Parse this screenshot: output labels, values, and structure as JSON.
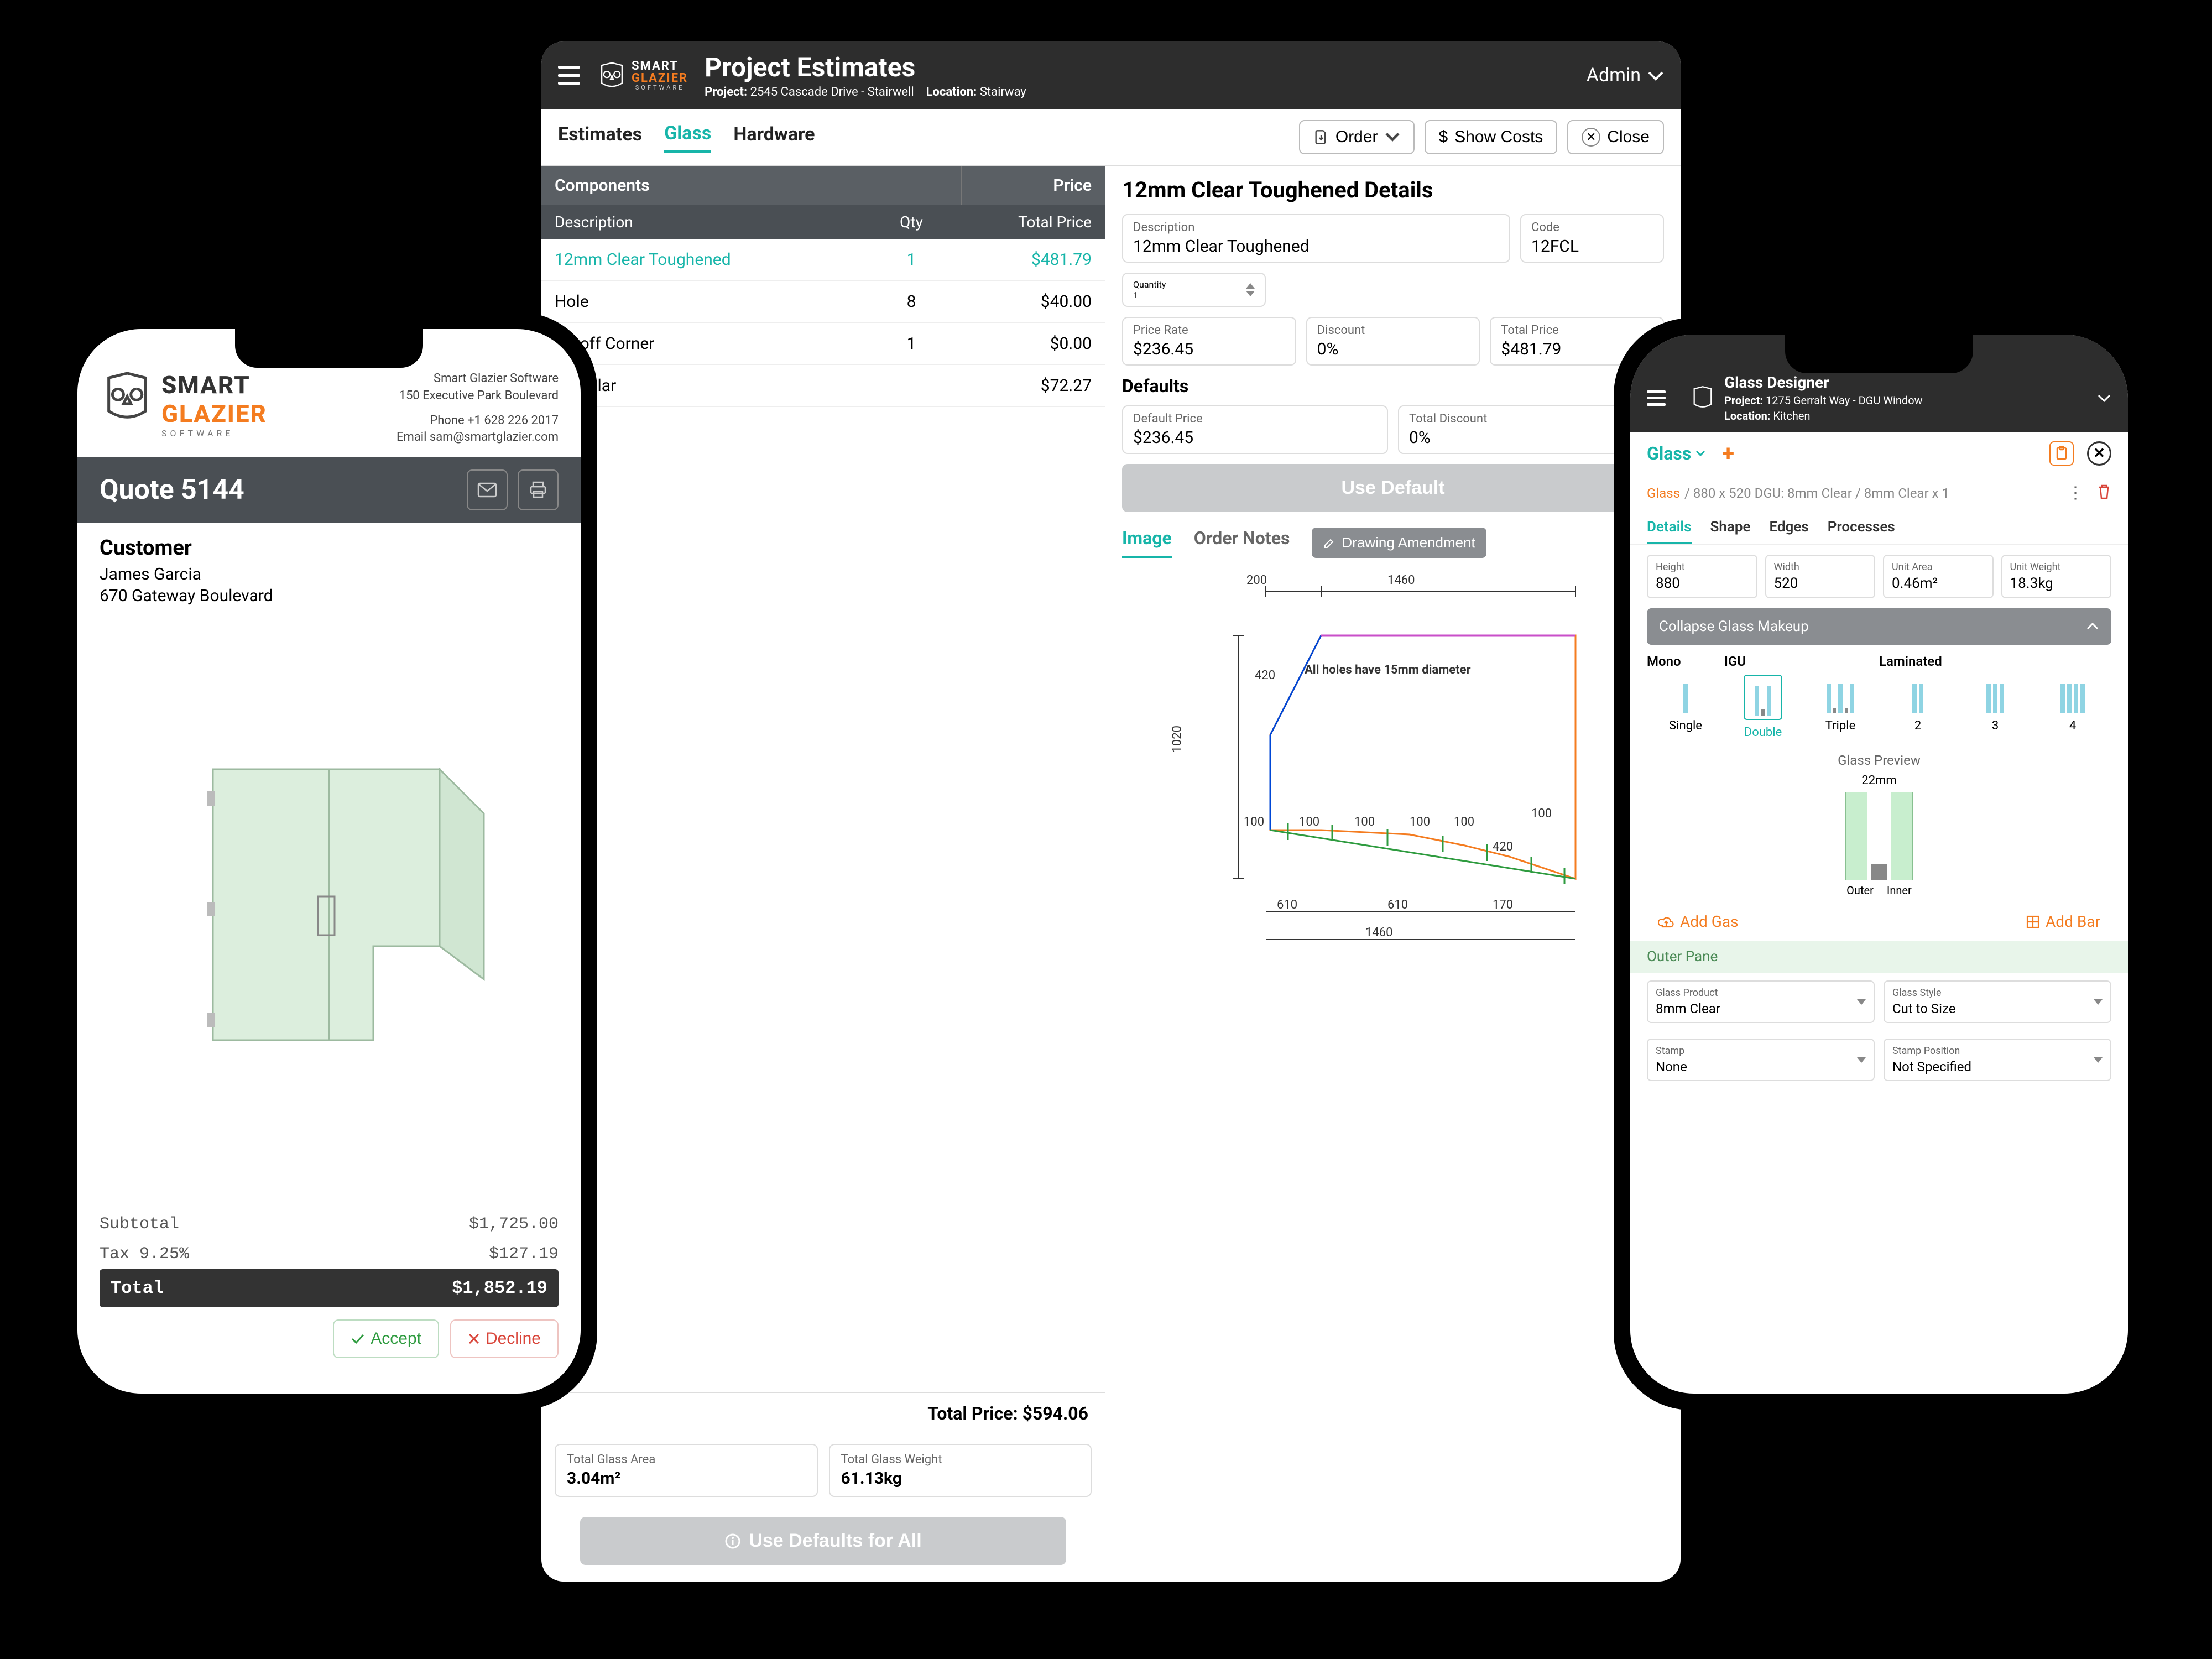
{
  "tablet": {
    "brand": {
      "smart": "SMART",
      "glazier": "GLAZIER",
      "software": "SOFTWARE"
    },
    "title": "Project Estimates",
    "project_lbl": "Project:",
    "project_val": "2545 Cascade Drive - Stairwell",
    "location_lbl": "Location:",
    "location_val": "Stairway",
    "admin": "Admin",
    "tabs": [
      "Estimates",
      "Glass",
      "Hardware"
    ],
    "active_tab": 1,
    "toolbar": {
      "order": "Order",
      "show_costs": "Show Costs",
      "close": "Close"
    },
    "comp_head": {
      "components": "Components",
      "price": "Price",
      "description": "Description",
      "qty": "Qty",
      "total_price": "Total Price"
    },
    "rows": [
      {
        "desc": "12mm Clear Toughened",
        "qty": "1",
        "price": "$481.79",
        "sel": true
      },
      {
        "desc": "Hole",
        "qty": "8",
        "price": "$40.00"
      },
      {
        "desc": "Cutoff Corner",
        "qty": "1",
        "price": "$0.00"
      },
      {
        "desc": "Irregular",
        "qty": "",
        "price": "$72.27"
      }
    ],
    "total_price_lbl": "Total Price:",
    "total_price_val": "$594.06",
    "stat1_lbl": "Total Glass Area",
    "stat1_val": "3.04m²",
    "stat2_lbl": "Total Glass Weight",
    "stat2_val": "61.13kg",
    "use_defaults_all": "Use Defaults for All",
    "details": {
      "title": "12mm Clear Toughened Details",
      "desc_lbl": "Description",
      "desc_val": "12mm Clear Toughened",
      "code_lbl": "Code",
      "code_val": "12FCL",
      "qty_lbl": "Quantity",
      "qty_val": "1",
      "rate_lbl": "Price Rate",
      "rate_val": "$236.45",
      "disc_lbl": "Discount",
      "disc_val": "0%",
      "tp_lbl": "Total Price",
      "tp_val": "$481.79",
      "defaults": "Defaults",
      "dp_lbl": "Default Price",
      "dp_val": "$236.45",
      "td_lbl": "Total Discount",
      "td_val": "0%",
      "use_default": "Use Default",
      "tab_image": "Image",
      "tab_notes": "Order Notes",
      "draw_amend": "Drawing Amendment",
      "note": "All holes have 15mm diameter",
      "dims": {
        "w1": "200",
        "w2": "1460",
        "h": "1020",
        "h2": "420",
        "b100": "100",
        "b420": "420",
        "b610": "610",
        "b170": "170"
      }
    }
  },
  "phone1": {
    "brand": {
      "smart": "SMART",
      "glazier": "GLAZIER",
      "software": "SOFTWARE"
    },
    "company": "Smart Glazier Software",
    "addr": "150 Executive Park Boulevard",
    "phone": "Phone +1 628 226 2017",
    "email": "Email sam@smartglazier.com",
    "quote_title": "Quote 5144",
    "customer_lbl": "Customer",
    "customer_name": "James Garcia",
    "customer_addr": "670 Gateway Boulevard",
    "subtotal_lbl": "Subtotal",
    "subtotal_val": "$1,725.00",
    "tax_lbl": "Tax 9.25%",
    "tax_val": "$127.19",
    "total_lbl": "Total",
    "total_val": "$1,852.19",
    "accept": "Accept",
    "decline": "Decline"
  },
  "phone2": {
    "title": "Glass Designer",
    "project_lbl": "Project:",
    "project_val": "1275 Gerralt Way - DGU Window",
    "location_lbl": "Location:",
    "location_val": "Kitchen",
    "glass_dd": "Glass",
    "crumb_glass": "Glass",
    "crumb_desc": "/ 880 x 520 DGU: 8mm Clear / 8mm Clear x 1",
    "tabs": [
      "Details",
      "Shape",
      "Edges",
      "Processes"
    ],
    "fields": {
      "h_lbl": "Height",
      "h_val": "880",
      "w_lbl": "Width",
      "w_val": "520",
      "ua_lbl": "Unit Area",
      "ua_val": "0.46m²",
      "uw_lbl": "Unit Weight",
      "uw_val": "18.3kg"
    },
    "collapse": "Collapse Glass Makeup",
    "cats": {
      "mono": "Mono",
      "igu": "IGU",
      "lam": "Laminated"
    },
    "items": [
      "Single",
      "Double",
      "Triple",
      "2",
      "3",
      "4"
    ],
    "preview_lbl": "Glass Preview",
    "preview_dim": "22mm",
    "outer": "Outer",
    "inner": "Inner",
    "add_gas": "Add Gas",
    "add_bar": "Add Bar",
    "outer_pane": "Outer Pane",
    "sel": {
      "gp_lbl": "Glass Product",
      "gp_val": "8mm Clear",
      "gs_lbl": "Glass Style",
      "gs_val": "Cut to Size",
      "st_lbl": "Stamp",
      "st_val": "None",
      "sp_lbl": "Stamp Position",
      "sp_val": "Not Specified"
    }
  }
}
